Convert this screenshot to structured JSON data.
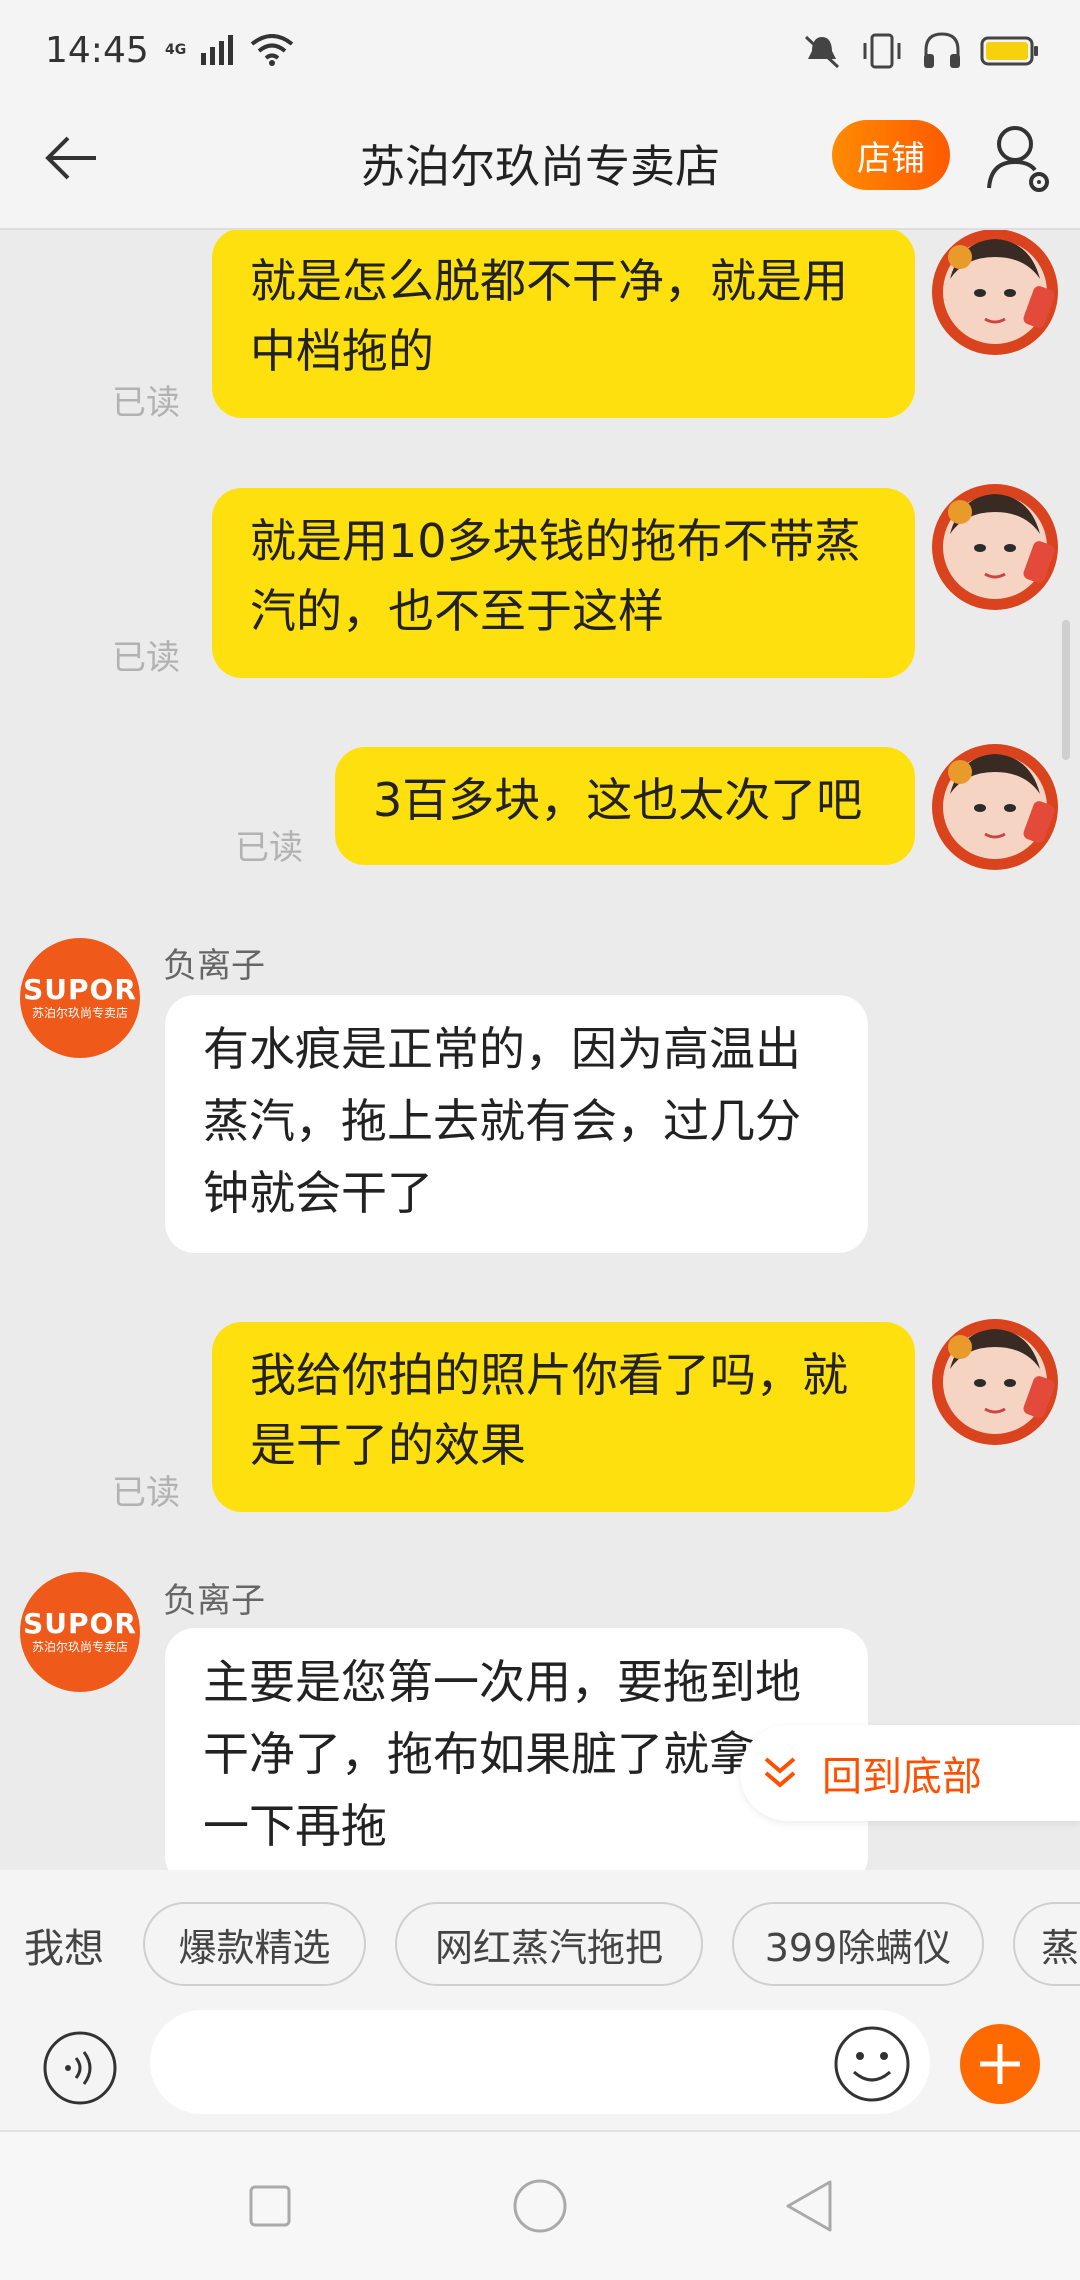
{
  "status_bar": {
    "time": "14:45",
    "network": "4G"
  },
  "header": {
    "title": "苏泊尔玖尚专卖店",
    "shop_button": "店铺"
  },
  "messages": [
    {
      "from": "me",
      "lines": [
        "就是怎么脱都不干净，就是用",
        "中档拖的"
      ],
      "status": "已读"
    },
    {
      "from": "me",
      "lines": [
        "就是用10多块钱的拖布不带蒸",
        "汽的，也不至于这样"
      ],
      "status": "已读"
    },
    {
      "from": "me",
      "lines": [
        "3百多块，这也太次了吧"
      ],
      "status": "已读"
    },
    {
      "from": "shop",
      "sender": "负离子",
      "lines": [
        "有水痕是正常的，因为高温出",
        "蒸汽，拖上去就有会，过几分",
        "钟就会干了"
      ]
    },
    {
      "from": "me",
      "lines": [
        "我给你拍的照片你看了吗，就",
        "是干了的效果"
      ],
      "status": "已读"
    },
    {
      "from": "shop",
      "sender": "负离子",
      "lines": [
        "主要是您第一次用，要拖到地",
        "干净了，拖布如果脏了就拿水洗",
        "一下再拖"
      ]
    }
  ],
  "shop_avatar": {
    "brand": "SUPOR",
    "sub": "苏泊尔玖尚专卖店"
  },
  "back_to_bottom": "回到底部",
  "quick_bar": {
    "label": "我想",
    "chips": [
      "爆款精选",
      "网红蒸汽拖把",
      "399除螨仪",
      "蒸"
    ]
  },
  "input": {
    "placeholder": ""
  },
  "colors": {
    "accent": "#ff5000",
    "my_bubble": "#ffe00f",
    "shop_brand": "#ef5a1b"
  }
}
